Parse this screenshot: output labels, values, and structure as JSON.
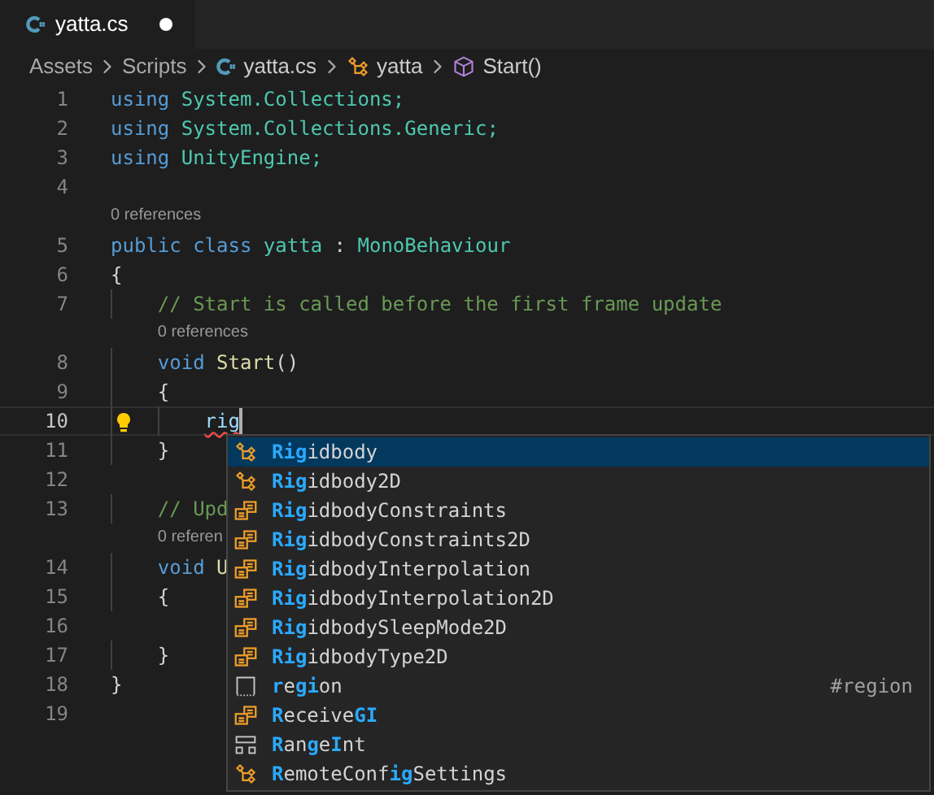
{
  "tabs": [
    {
      "label": "yatta.cs",
      "selected": true,
      "modified": true
    }
  ],
  "breadcrumb": [
    {
      "label": "Assets",
      "kind": "folder"
    },
    {
      "label": "Scripts",
      "kind": "folder"
    },
    {
      "label": "yatta.cs",
      "kind": "file"
    },
    {
      "label": "yatta",
      "kind": "class"
    },
    {
      "label": "Start()",
      "kind": "method"
    }
  ],
  "lines": [
    {
      "kind": "code",
      "number": "1",
      "current": false,
      "tokens": [
        {
          "text": "using",
          "kind": "keyword"
        },
        {
          "text": " System.Collections;",
          "kind": "type"
        }
      ]
    },
    {
      "kind": "code",
      "number": "2",
      "current": false,
      "tokens": [
        {
          "text": "using",
          "kind": "keyword"
        },
        {
          "text": " System.Collections.Generic;",
          "kind": "type"
        }
      ]
    },
    {
      "kind": "code",
      "number": "3",
      "current": false,
      "tokens": [
        {
          "text": "using",
          "kind": "keyword"
        },
        {
          "text": " UnityEngine;",
          "kind": "type"
        }
      ]
    },
    {
      "kind": "code",
      "number": "4",
      "current": false
    },
    {
      "kind": "codelens",
      "text": "0 references"
    },
    {
      "kind": "code",
      "number": "5",
      "current": false,
      "tokens": [
        {
          "text": "public class",
          "kind": "keyword"
        },
        {
          "text": " yatta",
          "kind": "type"
        },
        {
          "text": " : ",
          "kind": "plain"
        },
        {
          "text": "MonoBehaviour",
          "kind": "type"
        }
      ]
    },
    {
      "kind": "code",
      "number": "6",
      "current": false,
      "tokens": [
        {
          "text": "{",
          "kind": "plain"
        }
      ]
    },
    {
      "kind": "code",
      "number": "7",
      "current": false,
      "tokens": [
        {
          "text": "    // Start is called before the first frame update",
          "kind": "comment"
        }
      ]
    },
    {
      "kind": "codelens",
      "text": "0 references"
    },
    {
      "kind": "code",
      "number": "8",
      "current": false,
      "tokens": [
        {
          "text": "    void",
          "kind": "keyword"
        },
        {
          "text": " Start",
          "kind": "method"
        },
        {
          "text": "()",
          "kind": "plain"
        }
      ]
    },
    {
      "kind": "code",
      "number": "9",
      "current": false,
      "tokens": [
        {
          "text": "    {",
          "kind": "plain"
        }
      ]
    },
    {
      "kind": "code",
      "number": "10",
      "current": true,
      "tokens": [
        {
          "text": "        rig",
          "kind": "error"
        }
      ]
    },
    {
      "kind": "code",
      "number": "11",
      "current": false,
      "tokens": [
        {
          "text": "    }",
          "kind": "plain"
        }
      ]
    },
    {
      "kind": "code",
      "number": "12",
      "current": false
    },
    {
      "kind": "code",
      "number": "13",
      "current": false,
      "tokens": [
        {
          "text": "    // Upd",
          "kind": "comment"
        }
      ]
    },
    {
      "kind": "codelens",
      "text": "0 referen"
    },
    {
      "kind": "code",
      "number": "14",
      "current": false,
      "tokens": [
        {
          "text": "    void",
          "kind": "keyword"
        },
        {
          "text": " U",
          "kind": "method"
        }
      ]
    },
    {
      "kind": "code",
      "number": "15",
      "current": false,
      "tokens": [
        {
          "text": "    {",
          "kind": "plain"
        }
      ]
    },
    {
      "kind": "code",
      "number": "16",
      "current": false
    },
    {
      "kind": "code",
      "number": "17",
      "current": false,
      "tokens": [
        {
          "text": "    }",
          "kind": "plain"
        }
      ]
    },
    {
      "kind": "code",
      "number": "18",
      "current": false,
      "tokens": [
        {
          "text": "}",
          "kind": "plain"
        }
      ]
    },
    {
      "kind": "code",
      "number": "19",
      "current": false
    }
  ],
  "suggestions": [
    {
      "kind": "class",
      "selected": true,
      "parts": [
        {
          "text": "Rig",
          "match": true
        },
        {
          "text": "idbody",
          "match": false
        }
      ]
    },
    {
      "kind": "class",
      "selected": false,
      "parts": [
        {
          "text": "Rig",
          "match": true
        },
        {
          "text": "idbody2D",
          "match": false
        }
      ]
    },
    {
      "kind": "enum",
      "selected": false,
      "parts": [
        {
          "text": "Rig",
          "match": true
        },
        {
          "text": "idbodyConstraints",
          "match": false
        }
      ]
    },
    {
      "kind": "enum",
      "selected": false,
      "parts": [
        {
          "text": "Rig",
          "match": true
        },
        {
          "text": "idbodyConstraints2D",
          "match": false
        }
      ]
    },
    {
      "kind": "enum",
      "selected": false,
      "parts": [
        {
          "text": "Rig",
          "match": true
        },
        {
          "text": "idbodyInterpolation",
          "match": false
        }
      ]
    },
    {
      "kind": "enum",
      "selected": false,
      "parts": [
        {
          "text": "Rig",
          "match": true
        },
        {
          "text": "idbodyInterpolation2D",
          "match": false
        }
      ]
    },
    {
      "kind": "enum",
      "selected": false,
      "parts": [
        {
          "text": "Rig",
          "match": true
        },
        {
          "text": "idbodySleepMode2D",
          "match": false
        }
      ]
    },
    {
      "kind": "enum",
      "selected": false,
      "parts": [
        {
          "text": "Rig",
          "match": true
        },
        {
          "text": "idbodyType2D",
          "match": false
        }
      ]
    },
    {
      "kind": "snippet",
      "selected": false,
      "parts": [
        {
          "text": "r",
          "match": true
        },
        {
          "text": "e",
          "match": false
        },
        {
          "text": "gi",
          "match": true
        },
        {
          "text": "on",
          "match": false
        }
      ],
      "detail": "#region"
    },
    {
      "kind": "enum",
      "selected": false,
      "parts": [
        {
          "text": "R",
          "match": true
        },
        {
          "text": "eceive",
          "match": false
        },
        {
          "text": "GI",
          "match": true
        }
      ]
    },
    {
      "kind": "struct",
      "selected": false,
      "parts": [
        {
          "text": "R",
          "match": true
        },
        {
          "text": "an",
          "match": false
        },
        {
          "text": "g",
          "match": true
        },
        {
          "text": "e",
          "match": false
        },
        {
          "text": "I",
          "match": true
        },
        {
          "text": "nt",
          "match": false
        }
      ]
    },
    {
      "kind": "class",
      "selected": false,
      "parts": [
        {
          "text": "R",
          "match": true
        },
        {
          "text": "emoteConf",
          "match": false
        },
        {
          "text": "ig",
          "match": true
        },
        {
          "text": "Settings",
          "match": false
        }
      ]
    }
  ]
}
